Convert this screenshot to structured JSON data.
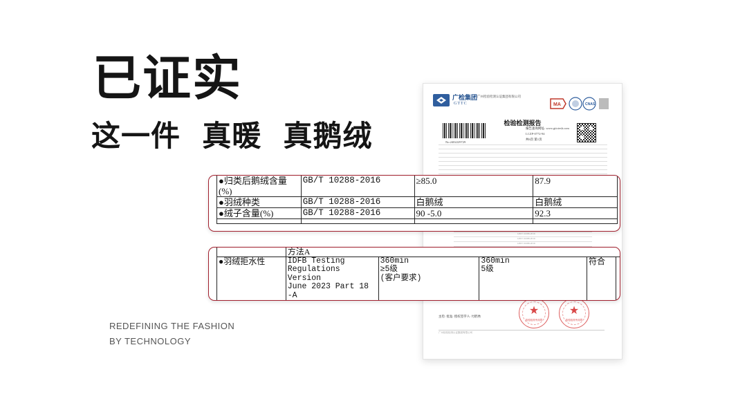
{
  "headline": "已证实",
  "subline": "这一件  真暖  真鹅绒",
  "tagline": [
    "REDEFINING THE FASHION",
    "BY TECHNOLOGY"
  ],
  "report": {
    "brand": "广检集团",
    "brand_en": "GTTC",
    "org": "广州检验检测认证集团有限公司",
    "title": "检验检测报告",
    "barcode_no": "No:2402229729",
    "report_meta": [
      "报告查询网址: www.gttctesh.com",
      "LCZP-0772-94",
      "共6页 第1页"
    ],
    "table_cells": [
      "GB/T 10288-2016",
      "GB/T 10288-2016",
      "GB/T 10288-2016",
      "GB/T 14272-2011",
      "GB/T 14272-2011"
    ],
    "signer": "主检: 批准: 授权签字人: 付鹤秀",
    "footer": "广州检验检测认证集团有限公司",
    "seals": [
      "检验检测专用章",
      "检验检测专用章"
    ]
  },
  "zoom_table_1": {
    "rows": [
      {
        "bullet": "●",
        "item": "归类后鹅绒含量(%)",
        "standard": "GB/T 10288-2016",
        "requirement": "≥85.0",
        "result": "87.9"
      },
      {
        "bullet": "●",
        "item": "羽绒种类",
        "standard": "GB/T 10288-2016",
        "requirement": "白鹅绒",
        "result": "白鹅绒"
      },
      {
        "bullet": "●",
        "item": "绒子含量(%)",
        "standard": "GB/T 10288-2016",
        "requirement": "90 -5.0",
        "result": "92.3"
      }
    ]
  },
  "zoom_table_2": {
    "method": "方法A",
    "row": {
      "bullet": "●",
      "item": "羽绒拒水性",
      "standard_lines": [
        "IDFB Testing",
        "Regulations Version",
        "June 2023 Part 18",
        "-A"
      ],
      "requirement_lines": [
        "360min",
        "≥5级",
        "(客户要求)"
      ],
      "result_lines": [
        "360min",
        "5级"
      ],
      "judgement": "符合"
    }
  }
}
